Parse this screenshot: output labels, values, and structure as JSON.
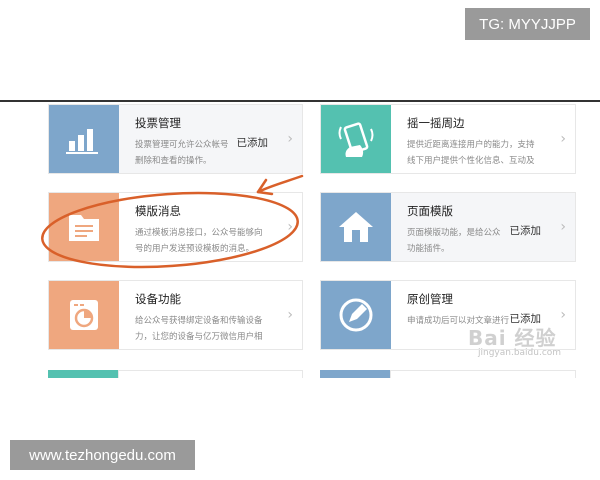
{
  "overlays": {
    "tg_text": "TG: MYYJJPP",
    "site_text": "www.tezhongedu.com"
  },
  "colors": {
    "blue_tile": "#7ea6cb",
    "teal_tile": "#54c1b0",
    "orange_tile": "#efa77f",
    "annotation": "#d9602a"
  },
  "cards": [
    {
      "title": "投票管理",
      "desc": "投票管理可允许公众帐号\n删除和查看的操作。",
      "status": "已添加",
      "icon": "bar-chart-icon"
    },
    {
      "title": "摇一摇周边",
      "desc": "提供近距离连接用户的能力，支持\n线下用户提供个性化信息、互动及",
      "status": "",
      "icon": "shake-phone-icon"
    },
    {
      "title": "模版消息",
      "desc": "通过模板消息接口，公众号能够向\n号的用户发送预设模板的消息。",
      "status": "",
      "icon": "document-icon"
    },
    {
      "title": "页面模版",
      "desc": "页面模版功能，是给公众\n功能插件。",
      "status": "已添加",
      "icon": "home-icon"
    },
    {
      "title": "设备功能",
      "desc": "给公众号获得绑定设备和传输设备\n力，让您的设备与亿万微信用户相",
      "status": "",
      "icon": "device-icon"
    },
    {
      "title": "原创管理",
      "desc": "申请成功后可以对文章进行",
      "status": "已添加",
      "icon": "edit-circle-icon"
    }
  ],
  "watermark": {
    "logo": "Bai 经验",
    "url": "jingyan.baidu.com"
  }
}
